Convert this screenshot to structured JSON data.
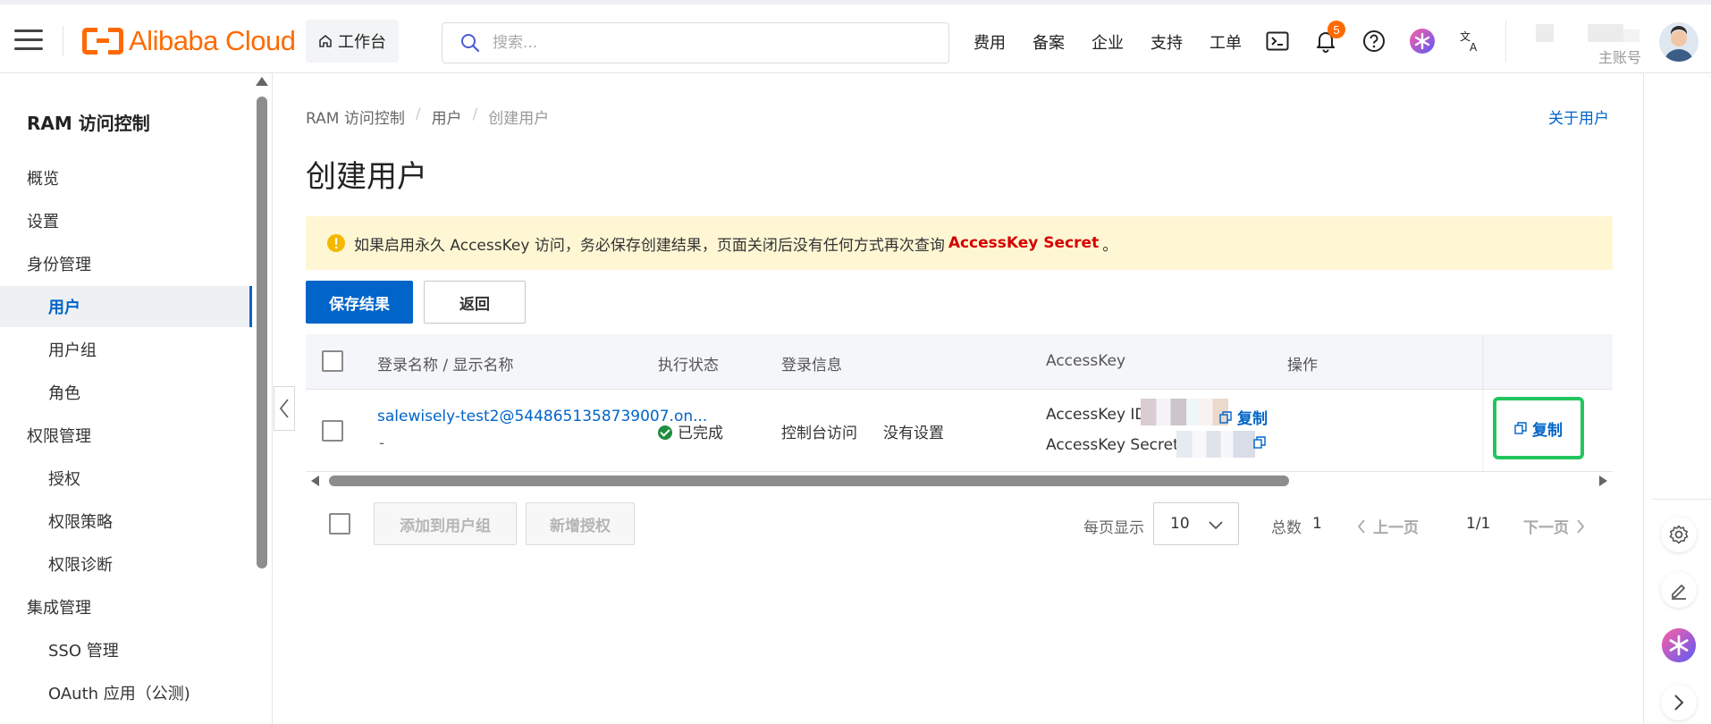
{
  "topbar": {
    "logo_text": "Alibaba Cloud",
    "workbench_label": "工作台",
    "search_placeholder": "搜索...",
    "nav": [
      "费用",
      "备案",
      "企业",
      "支持",
      "工单"
    ],
    "notification_count": "5",
    "account_label": "主账号",
    "brand_color": "#ff6a00"
  },
  "sidebar": {
    "title": "RAM 访问控制",
    "items": [
      {
        "label": "概览",
        "level": 1
      },
      {
        "label": "设置",
        "level": 1
      },
      {
        "label": "身份管理",
        "level": 1
      },
      {
        "label": "用户",
        "level": 2,
        "active": true
      },
      {
        "label": "用户组",
        "level": 2
      },
      {
        "label": "角色",
        "level": 2
      },
      {
        "label": "权限管理",
        "level": 1
      },
      {
        "label": "授权",
        "level": 2
      },
      {
        "label": "权限策略",
        "level": 2
      },
      {
        "label": "权限诊断",
        "level": 2
      },
      {
        "label": "集成管理",
        "level": 1
      },
      {
        "label": "SSO 管理",
        "level": 2
      },
      {
        "label": "OAuth 应用（公测)",
        "level": 2
      }
    ]
  },
  "breadcrumb": [
    "RAM 访问控制",
    "用户",
    "创建用户"
  ],
  "about_link": "关于用户",
  "page_title": "创建用户",
  "alert": {
    "text_before": "如果启用永久 AccessKey 访问，务必保存创建结果，页面关闭后没有任何方式再次查询",
    "strong": "AccessKey Secret",
    "text_after": "。"
  },
  "actions": {
    "save": "保存结果",
    "back": "返回"
  },
  "table": {
    "headers": [
      "登录名称 / 显示名称",
      "执行状态",
      "登录信息",
      "AccessKey",
      "操作"
    ],
    "row": {
      "login_name": "salewisely-test2@5448651358739007.on...",
      "display_name": "-",
      "status": "已完成",
      "login_info_1": "控制台访问",
      "login_info_2": "没有设置",
      "ak_id_label": "AccessKey ID",
      "ak_secret_label": "AccessKey Secret",
      "copy_label": "复制",
      "op_copy_label": "复制"
    }
  },
  "footer": {
    "add_to_group": "添加到用户组",
    "add_permission": "新增授权",
    "per_page_label": "每页显示",
    "per_page_value": "10",
    "total_label": "总数",
    "total_value": "1",
    "prev": "上一页",
    "page_indicator": "1/1",
    "next": "下一页"
  },
  "colors": {
    "primary": "#0064c8",
    "alert_bg": "#fff7d4",
    "danger": "#d50000",
    "highlight_box": "#22c55e"
  }
}
